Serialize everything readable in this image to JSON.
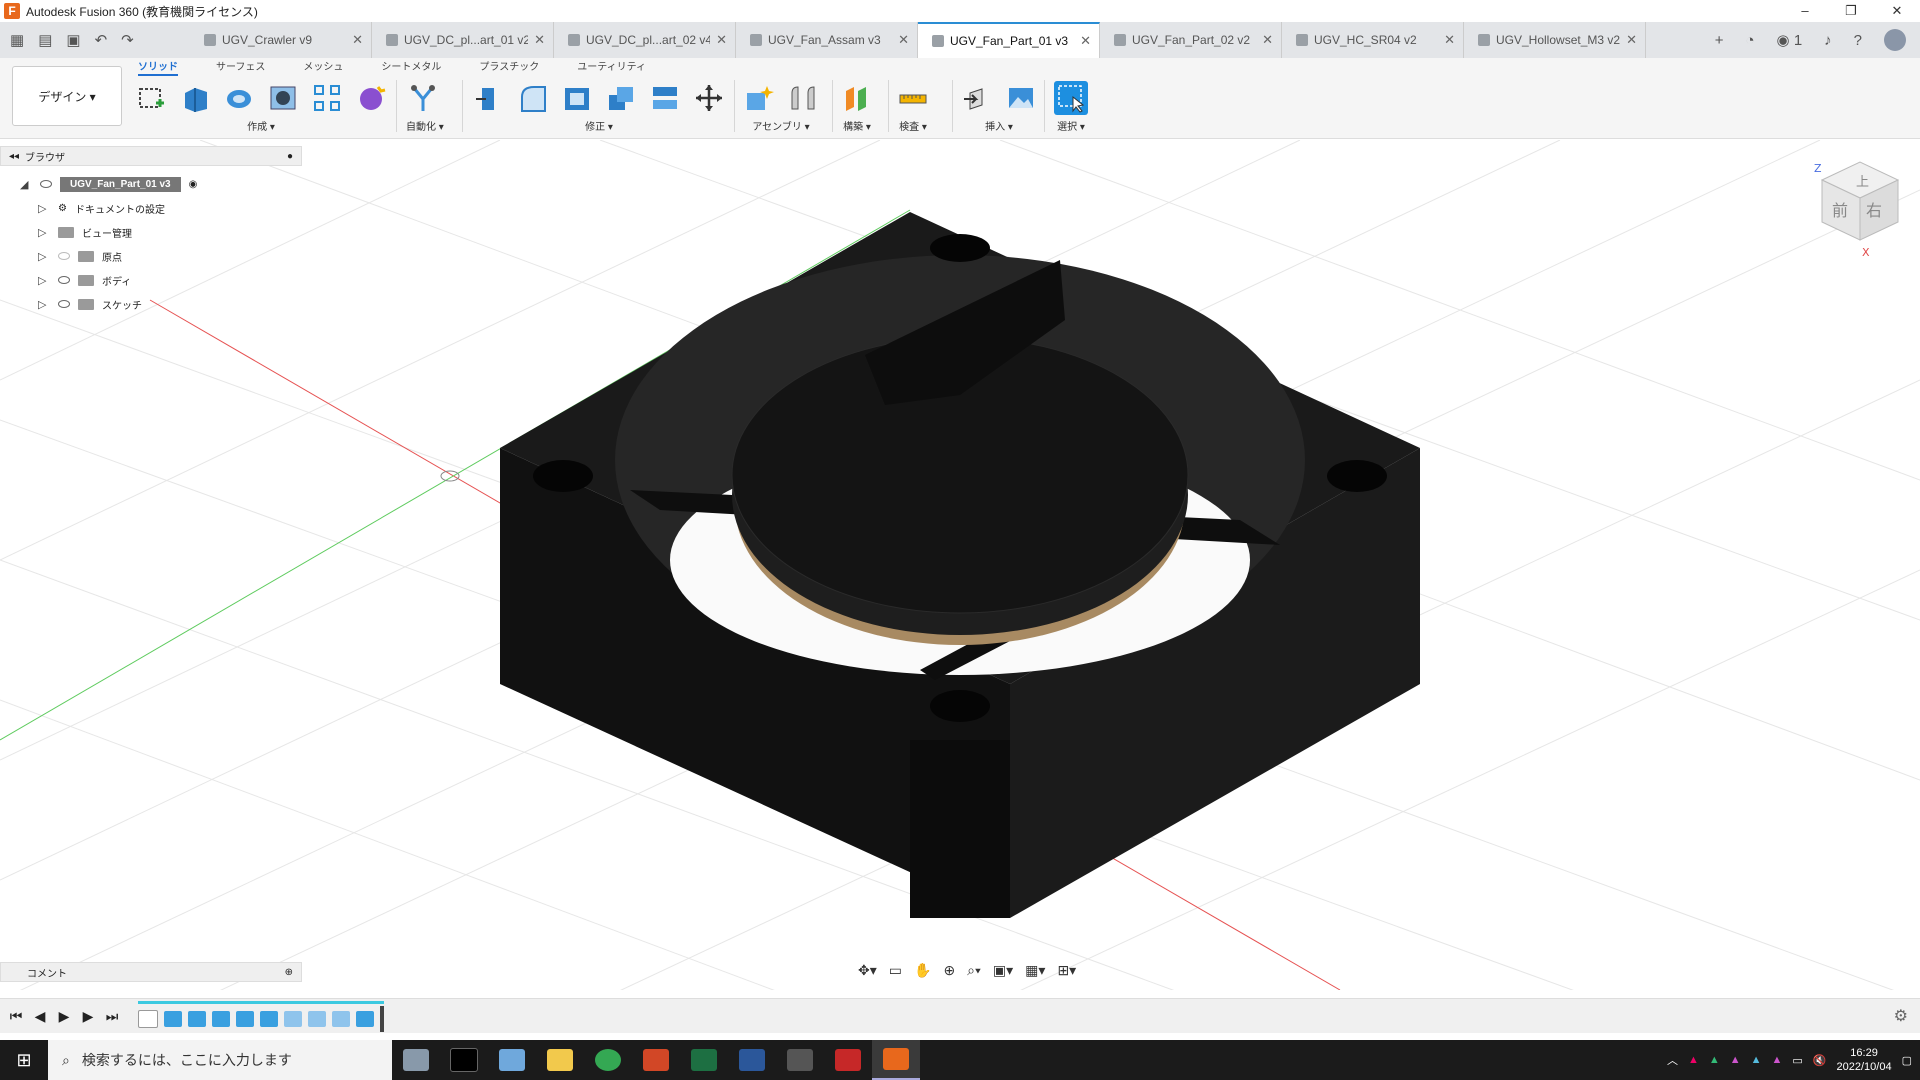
{
  "window": {
    "title": "Autodesk Fusion 360 (教育機関ライセンス)",
    "logo": "F",
    "controls": [
      "–",
      "❐",
      "✕"
    ]
  },
  "tabs": [
    {
      "label": "UGV_Crawler v9"
    },
    {
      "label": "UGV_DC_pl...art_01 v2"
    },
    {
      "label": "UGV_DC_pl...art_02 v4"
    },
    {
      "label": "UGV_Fan_Assam v3"
    },
    {
      "label": "UGV_Fan_Part_01 v3",
      "active": true
    },
    {
      "label": "UGV_Fan_Part_02 v2"
    },
    {
      "label": "UGV_HC_SR04 v2"
    },
    {
      "label": "UGV_Hollowset_M3 v2"
    }
  ],
  "tab_close": "✕",
  "tabbar_right": {
    "add": "+",
    "count": "1"
  },
  "toolbar": {
    "workspace": "デザイン ▾",
    "ws_tabs": [
      "ソリッド",
      "サーフェス",
      "メッシュ",
      "シートメタル",
      "プラスチック",
      "ユーティリティ"
    ],
    "groups": [
      "作成 ▾",
      "自動化 ▾",
      "修正 ▾",
      "アセンブリ ▾",
      "構築 ▾",
      "検査 ▾",
      "挿入 ▾",
      "選択 ▾"
    ]
  },
  "browser": {
    "title": "ブラウザ",
    "root": "UGV_Fan_Part_01 v3",
    "items": [
      "ドキュメントの設定",
      "ビュー管理",
      "原点",
      "ボディ",
      "スケッチ"
    ]
  },
  "viewcube": {
    "top": "上",
    "front": "前",
    "right": "右",
    "axis_z": "Z",
    "axis_x": "X"
  },
  "comment": {
    "label": "コメント"
  },
  "taskbar": {
    "search_placeholder": "検索するには、ここに入力します",
    "time": "16:29",
    "date": "2022/10/04"
  },
  "colors": {
    "accent": "#2a8dd4",
    "model": "#141414",
    "grid": "#d9d9d9"
  }
}
